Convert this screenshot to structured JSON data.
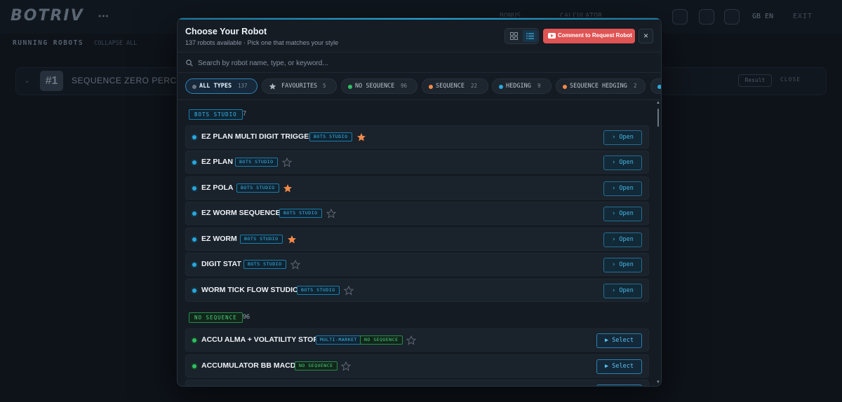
{
  "background": {
    "brand": "BOTRIV",
    "brand_dots": "•••",
    "nav": [
      "BONUS",
      "CALCULATOR"
    ],
    "lang": "GB EN",
    "exit": "EXIT",
    "running_label": "RUNNING ROBOTS",
    "collapse_label": "COLLAPSE ALL",
    "row_index": "#1",
    "row_title": "SEQUENCE ZERO PERCENT",
    "row_result": "Result",
    "row_close": "CLOSE"
  },
  "modal": {
    "title": "Choose Your Robot",
    "subtitle": "137 robots available · Pick one that matches your style",
    "request_label": "Comment to Request Robot",
    "close_label": "×"
  },
  "search": {
    "placeholder": "Search by robot name, type, or keyword..."
  },
  "filters": [
    {
      "label": "ALL TYPES",
      "count": "137",
      "active": true,
      "dot": "#6b7683"
    },
    {
      "label": "FAVOURITES",
      "count": "5",
      "active": false,
      "dot": "star"
    },
    {
      "label": "NO SEQUENCE",
      "count": "96",
      "active": false,
      "dot": "#2fbf67"
    },
    {
      "label": "SEQUENCE",
      "count": "22",
      "active": false,
      "dot": "#f28a4b"
    },
    {
      "label": "HEDGING",
      "count": "9",
      "active": false,
      "dot": "#2aa8dc"
    },
    {
      "label": "SEQUENCE HEDGING",
      "count": "2",
      "active": false,
      "dot": "#f28a4b"
    }
  ],
  "sections": [
    {
      "tag": "BOTS STUDIO",
      "count": "7",
      "style": "studio",
      "robots": [
        {
          "name": "EZ PLAN MULTI DIGIT TRIGGER",
          "tags": [
            "BOTS STUDIO"
          ],
          "favourite": true,
          "action": "› Open"
        },
        {
          "name": "EZ PLAN",
          "tags": [
            "BOTS STUDIO"
          ],
          "favourite": false,
          "action": "› Open"
        },
        {
          "name": "EZ POLA",
          "tags": [
            "BOTS STUDIO"
          ],
          "favourite": true,
          "action": "› Open"
        },
        {
          "name": "EZ WORM SEQUENCE",
          "tags": [
            "BOTS STUDIO"
          ],
          "favourite": false,
          "action": "› Open"
        },
        {
          "name": "EZ WORM",
          "tags": [
            "BOTS STUDIO"
          ],
          "favourite": true,
          "action": "› Open"
        },
        {
          "name": "DIGIT STAT",
          "tags": [
            "BOTS STUDIO"
          ],
          "favourite": false,
          "action": "› Open"
        },
        {
          "name": "WORM TICK FLOW STUDIO",
          "tags": [
            "BOTS STUDIO"
          ],
          "favourite": false,
          "action": "› Open"
        }
      ]
    },
    {
      "tag": "NO SEQUENCE",
      "count": "96",
      "style": "noseq",
      "robots": [
        {
          "name": "ACCU ALMA + VOLATILITY STOP",
          "tags": [
            "MULTI-MARKET",
            "NO SEQUENCE"
          ],
          "favourite": false,
          "action": "▶ Select"
        },
        {
          "name": "ACCUMULATOR BB MACD",
          "tags": [
            "NO SEQUENCE"
          ],
          "favourite": false,
          "action": "▶ Select"
        }
      ]
    }
  ],
  "colors": {
    "accent": "#22a6d8",
    "favourite_star": "#f28a4b",
    "request_button": "#e05454"
  }
}
